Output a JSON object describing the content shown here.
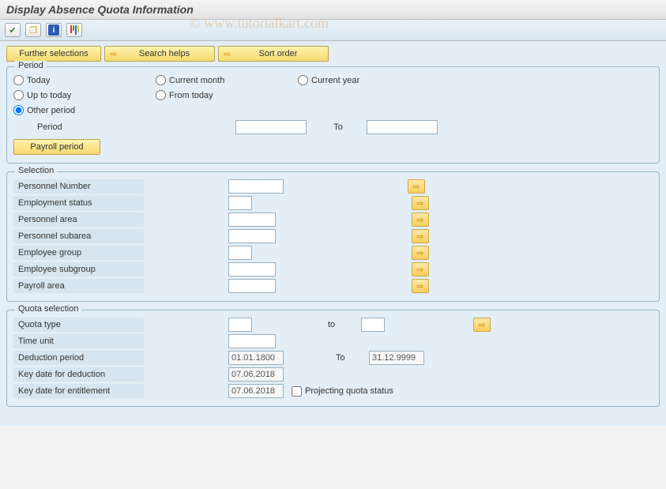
{
  "title": "Display Absence Quota Information",
  "watermark": "© www.tutorialkart.com",
  "toolbar": {
    "icons": [
      "clock-icon",
      "duplicate-icon",
      "info-icon",
      "layout-icon"
    ]
  },
  "buttons": {
    "further_selections": "Further selections",
    "search_helps": "Search helps",
    "sort_order": "Sort order"
  },
  "period_panel": {
    "title": "Period",
    "options": {
      "today": "Today",
      "current_month": "Current month",
      "current_year": "Current year",
      "up_to_today": "Up to today",
      "from_today": "From today",
      "other_period": "Other period"
    },
    "selected": "other_period",
    "period_label": "Period",
    "to_label": "To",
    "period_from": "",
    "period_to": "",
    "payroll_period_btn": "Payroll period"
  },
  "selection_panel": {
    "title": "Selection",
    "rows": [
      {
        "label": "Personnel Number",
        "value": "",
        "width": "w70"
      },
      {
        "label": "Employment status",
        "value": "",
        "width": "w30"
      },
      {
        "label": "Personnel area",
        "value": "",
        "width": "w50"
      },
      {
        "label": "Personnel subarea",
        "value": "",
        "width": "w50"
      },
      {
        "label": "Employee group",
        "value": "",
        "width": "w30"
      },
      {
        "label": "Employee subgroup",
        "value": "",
        "width": "w50"
      },
      {
        "label": "Payroll area",
        "value": "",
        "width": "w50"
      }
    ]
  },
  "quota_panel": {
    "title": "Quota selection",
    "quota_type_label": "Quota type",
    "quota_type_from": "",
    "quota_to_label": "to",
    "quota_type_to": "",
    "time_unit_label": "Time unit",
    "time_unit": "",
    "deduction_period_label": "Deduction period",
    "deduction_from": "01.01.1800",
    "deduction_to_label": "To",
    "deduction_to": "31.12.9999",
    "key_deduction_label": "Key date for deduction",
    "key_deduction": "07.06.2018",
    "key_entitlement_label": "Key date for entitlement",
    "key_entitlement": "07.06.2018",
    "projecting_label": "Projecting quota status",
    "projecting_checked": false
  }
}
